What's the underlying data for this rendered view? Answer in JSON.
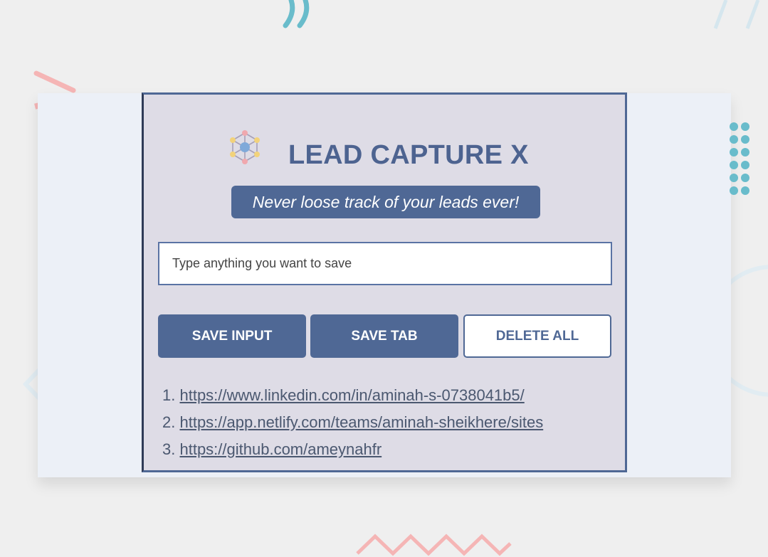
{
  "app": {
    "title": "LEAD CAPTURE X",
    "tagline": "Never loose track of your leads ever!",
    "logo_icon": "network-molecule-icon"
  },
  "input": {
    "placeholder": "Type anything you want to save",
    "value": ""
  },
  "buttons": {
    "save_input": "SAVE INPUT",
    "save_tab": "SAVE TAB",
    "delete_all": "DELETE ALL"
  },
  "leads": [
    {
      "number": "1.",
      "url": "https://www.linkedin.com/in/aminah-s-0738041b5/"
    },
    {
      "number": "2.",
      "url": "https://app.netlify.com/teams/aminah-sheikhere/sites"
    },
    {
      "number": "3.",
      "url": "https://github.com/ameynahfr"
    }
  ],
  "colors": {
    "primary": "#4f6895",
    "title": "#4d6390",
    "popup_bg": "#dedce6",
    "card_bg": "#ecf0f7",
    "page_bg": "#efefef",
    "deco_pink": "#f5b5b5",
    "deco_teal": "#69bccb",
    "deco_light_blue": "#d5e6ee"
  }
}
